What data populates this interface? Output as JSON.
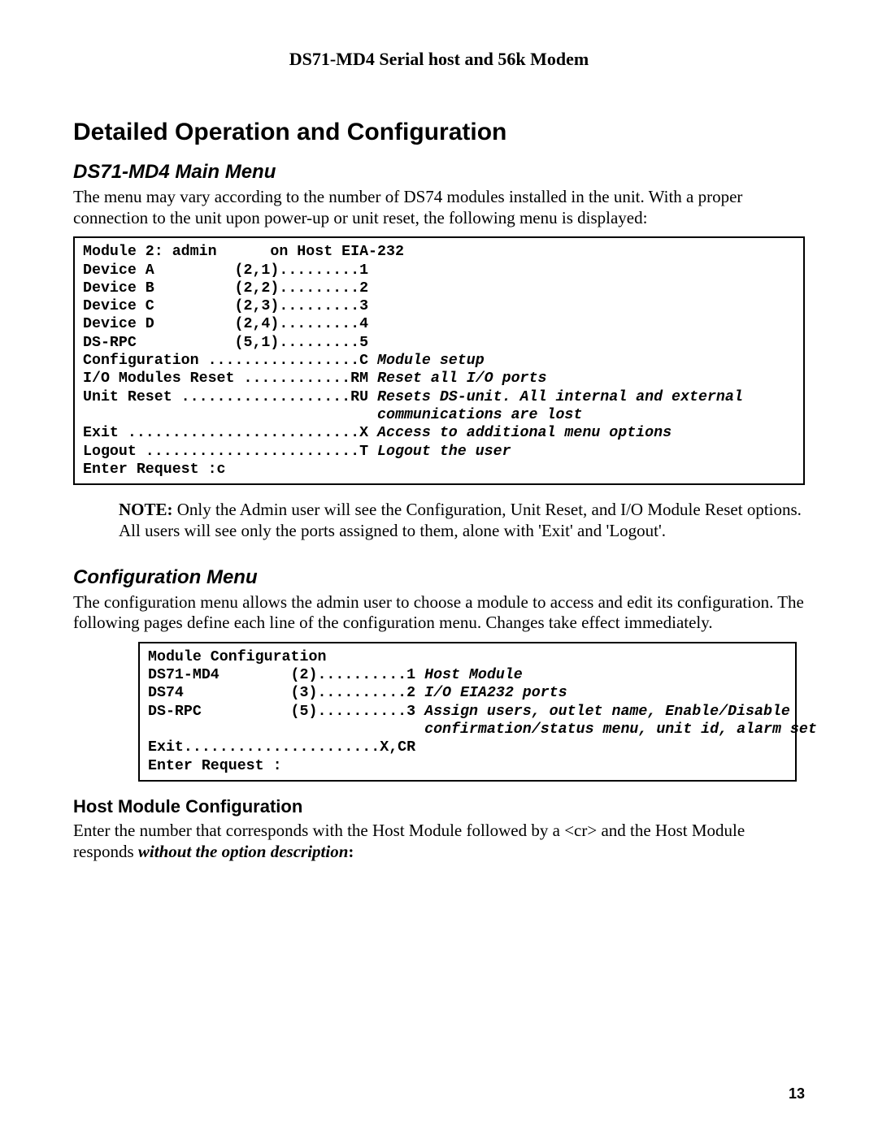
{
  "header": {
    "running": "DS71-MD4 Serial host and 56k Modem"
  },
  "section": {
    "title": "Detailed Operation and Configuration"
  },
  "main_menu": {
    "heading": "DS71-MD4 Main Menu",
    "intro": "The menu may vary according to the number of DS74 modules installed in the unit. With a proper connection to the unit upon power-up or unit reset, the following menu is displayed:",
    "t_header": "Module 2: admin      on Host EIA-232",
    "t_devA": "Device A         (2,1).........1",
    "t_devB": "Device B         (2,2).........2",
    "t_devC": "Device C         (2,3).........3",
    "t_devD": "Device D         (2,4).........4",
    "t_dsrpc": "DS-RPC           (5,1).........5",
    "t_conf_l": "Configuration .................C ",
    "t_conf_d": "Module setup",
    "t_io_l": "I/O Modules Reset ............RM ",
    "t_io_d": "Reset all I/O ports",
    "t_ur_l": "Unit Reset ...................RU ",
    "t_ur_d1": "Resets DS-unit. All internal and external",
    "t_ur_pad": "                                 ",
    "t_ur_d2": "communications are lost",
    "t_exit_l": "Exit ..........................X ",
    "t_exit_d": "Access to additional menu options",
    "t_log_l": "Logout ........................T ",
    "t_log_d": "Logout the user",
    "t_prompt": "Enter Request :c"
  },
  "note": {
    "label": "NOTE:",
    "text": " Only the Admin user will see the Configuration, Unit Reset, and I/O Module Reset options. All users will see only the ports assigned to them, alone with 'Exit' and 'Logout'."
  },
  "config_menu": {
    "heading": "Configuration Menu",
    "intro": "The configuration menu allows the admin user to choose a module to access and edit its configuration. The following pages define each line of the configuration menu. Changes take effect immediately.",
    "t_header": "Module Configuration",
    "t_r1_l": "DS71-MD4        (2)..........1 ",
    "t_r1_d": "Host Module",
    "t_r2_l": "DS74            (3)..........2 ",
    "t_r2_d": "I/O EIA232 ports",
    "t_r3_l": "DS-RPC          (5)..........3 ",
    "t_r3_d1": "Assign users, outlet name, Enable/Disable",
    "t_r3_pad": "                               ",
    "t_r3_d2": "confirmation/status menu, unit id, alarm set",
    "t_exit": "Exit......................X,CR",
    "t_prompt": "Enter Request :"
  },
  "host_mod": {
    "heading": "Host Module Configuration",
    "p_pre": "Enter the number that corresponds with the Host Module followed by a <cr> and the Host Module responds ",
    "p_bi": "without the option description",
    "p_post": ":"
  },
  "page_number": "13"
}
